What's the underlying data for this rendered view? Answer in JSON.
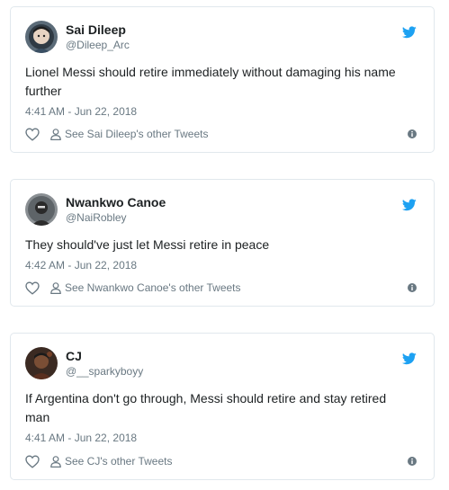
{
  "tweets": [
    {
      "name": "Sai Dileep",
      "handle": "@Dileep_Arc",
      "text": "Lionel Messi should retire immediately without damaging his name further",
      "time": "4:41 AM - Jun 22, 2018",
      "see_link": "See Sai Dileep's other Tweets"
    },
    {
      "name": "Nwankwo Canoe",
      "handle": "@NaiRobley",
      "text": "They should've just let Messi retire in peace",
      "time": "4:42 AM - Jun 22, 2018",
      "see_link": "See Nwankwo Canoe's other Tweets"
    },
    {
      "name": "CJ",
      "handle": "@__sparkyboyy",
      "text": "If Argentina don't go through, Messi should retire and stay retired man",
      "time": "4:41 AM - Jun 22, 2018",
      "see_link": "See CJ's other Tweets"
    }
  ],
  "colors": {
    "twitter_blue": "#1da1f2",
    "meta_gray": "#697882",
    "text": "#1c2022",
    "border": "#e1e8ed"
  },
  "icons": [
    "twitter-bird-icon",
    "heart-icon",
    "person-icon",
    "info-icon"
  ]
}
